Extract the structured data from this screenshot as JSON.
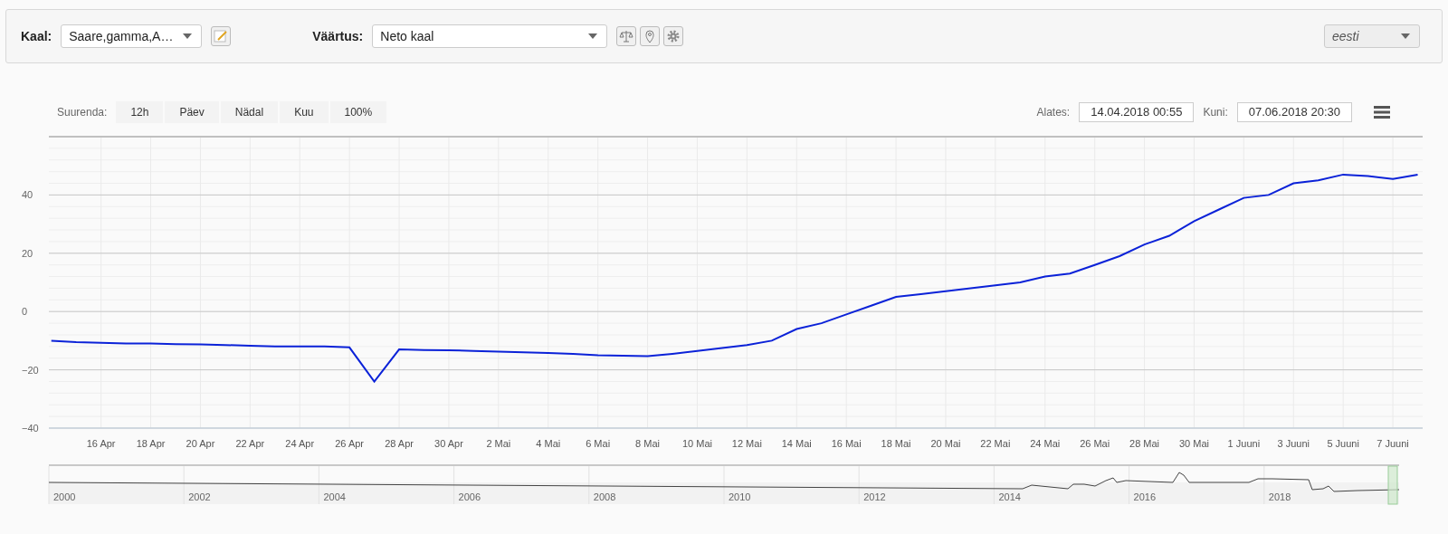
{
  "toolbar": {
    "scale_label": "Kaal:",
    "scale_select": {
      "value": "Saare,gamma,A…"
    },
    "value_label": "Väärtus:",
    "value_select": {
      "value": "Neto kaal"
    },
    "language_select": {
      "value": "eesti"
    }
  },
  "range_selector": {
    "label": "Suurenda:",
    "buttons": [
      {
        "label": "12h",
        "selected": false
      },
      {
        "label": "Päev",
        "selected": false
      },
      {
        "label": "Nädal",
        "selected": false
      },
      {
        "label": "Kuu",
        "selected": false
      },
      {
        "label": "100%",
        "selected": false
      }
    ],
    "from_label": "Alates:",
    "from_value": "14.04.2018 00:55",
    "to_label": "Kuni:",
    "to_value": "07.06.2018 20:30"
  },
  "chart": {
    "chart_data": {
      "type": "line",
      "grid": true,
      "ylim": [
        -40,
        60
      ],
      "yticks": [
        {
          "value": -40,
          "label": "−40"
        },
        {
          "value": -20,
          "label": "−20"
        },
        {
          "value": 0,
          "label": "0"
        },
        {
          "value": 20,
          "label": "20"
        },
        {
          "value": 40,
          "label": "40"
        }
      ],
      "categories": [
        null,
        null,
        "16 Apr",
        null,
        "18 Apr",
        null,
        "20 Apr",
        null,
        "22 Apr",
        null,
        "24 Apr",
        null,
        "26 Apr",
        null,
        "28 Apr",
        null,
        "30 Apr",
        null,
        "2 Mai",
        null,
        "4 Mai",
        null,
        "6 Mai",
        null,
        "8 Mai",
        null,
        "10 Mai",
        null,
        "12 Mai",
        null,
        "14 Mai",
        null,
        "16 Mai",
        null,
        "18 Mai",
        null,
        "20 Mai",
        null,
        "22 Mai",
        null,
        "24 Mai",
        null,
        "26 Mai",
        null,
        "28 Mai",
        null,
        "30 Mai",
        null,
        "1 Juuni",
        null,
        "3 Juuni",
        null,
        "5 Juuni",
        null,
        "7 Juuni",
        null
      ],
      "series": [
        {
          "color": "#0b22d8",
          "values": [
            -10,
            -10.5,
            -10.7,
            -11,
            -11,
            -11.2,
            -11.3,
            -11.5,
            -11.7,
            -12,
            -12,
            -12,
            -12.3,
            -24,
            -13,
            -13.2,
            -13.3,
            -13.5,
            -13.8,
            -14,
            -14.2,
            -14.5,
            -15,
            -15.2,
            -15.3,
            -14.5,
            -13.5,
            -12.5,
            -11.5,
            -10,
            -6,
            -4,
            -1,
            2,
            5,
            6,
            7,
            8,
            9,
            10,
            12,
            13,
            16,
            19,
            23,
            26,
            31,
            35,
            39,
            40,
            44,
            45,
            47,
            46.5,
            45.5,
            47
          ]
        }
      ]
    }
  },
  "navigator": {
    "year_labels": [
      "2000",
      "2002",
      "2004",
      "2006",
      "2008",
      "2010",
      "2012",
      "2014",
      "2016",
      "2018"
    ]
  }
}
